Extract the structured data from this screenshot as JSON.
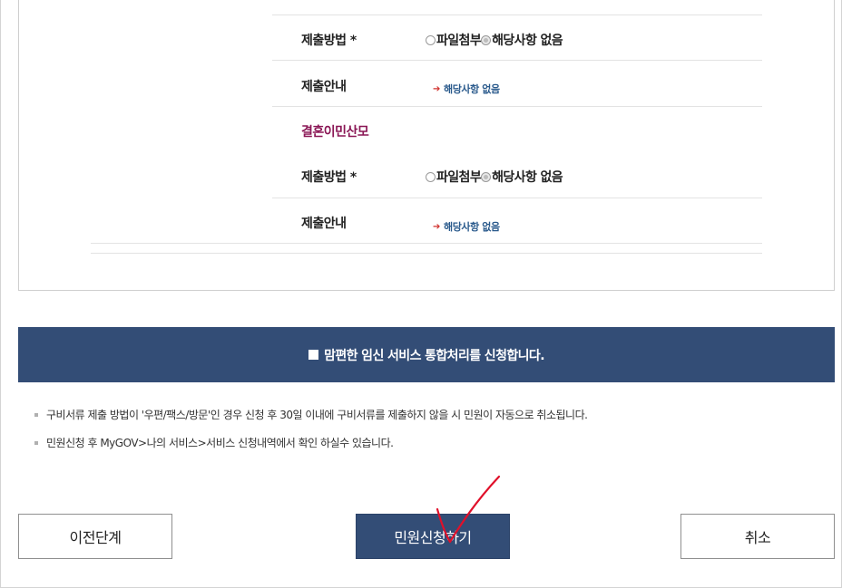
{
  "form": {
    "rows": [
      {
        "label": "제출방법 *",
        "option1": "파일첨부",
        "option2": "해당사항 없음"
      },
      {
        "label": "제출안내",
        "guide": "해당사항 없음"
      }
    ],
    "section_title": "결혼이민산모",
    "rows2": [
      {
        "label": "제출방법 *",
        "option1": "파일첨부",
        "option2": "해당사항 없음"
      },
      {
        "label": "제출안내",
        "guide": "해당사항 없음"
      }
    ]
  },
  "banner": {
    "text": "맘편한 임신 서비스 통합처리를 신청합니다."
  },
  "notices": [
    "구비서류 제출 방법이 '우편/팩스/방문'인 경우 신청 후 30일 이내에 구비서류를 제출하지 않을 시 민원이 자동으로 취소됩니다.",
    "민원신청 후 MyGOV>나의 서비스>서비스 신청내역에서 확인 하실수 있습니다."
  ],
  "buttons": {
    "prev": "이전단계",
    "submit": "민원신청하기",
    "cancel": "취소"
  },
  "colors": {
    "primary": "#334d76",
    "section_title": "#8a1655",
    "guide_text": "#2a5a8c",
    "annotation": "#e0102a"
  },
  "icons": {
    "guide_arrow": "arrow-right-icon",
    "banner_square": "square-icon",
    "notice_bullet": "bullet-icon"
  }
}
